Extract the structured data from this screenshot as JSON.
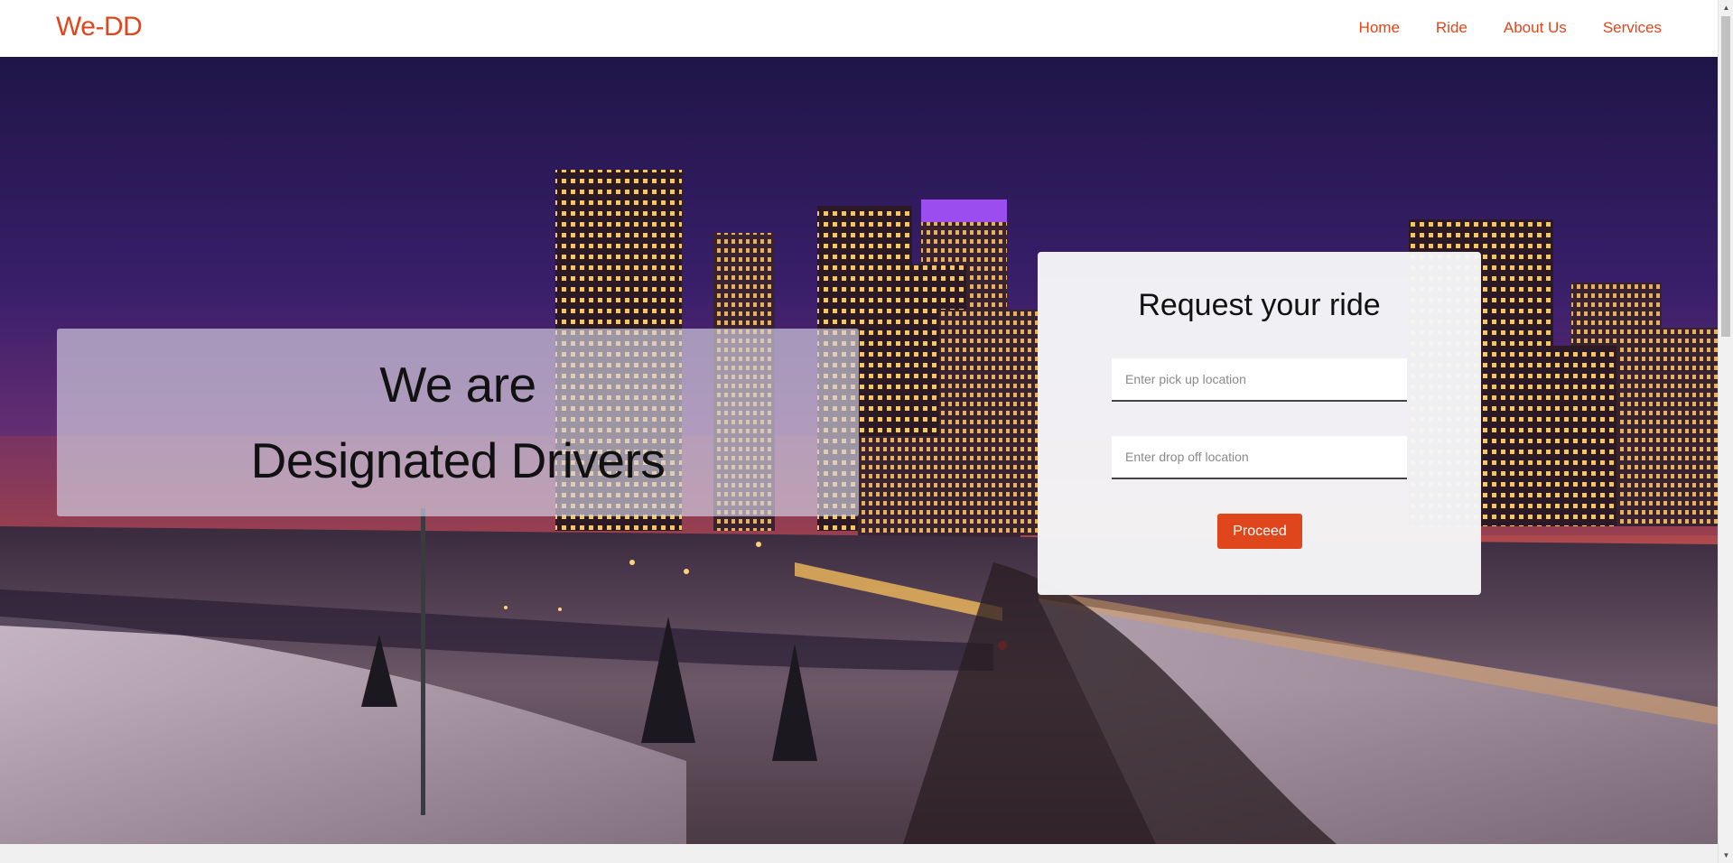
{
  "colors": {
    "accent": "#e0461c",
    "nav_text": "#e0461c",
    "button_bg": "#e0461c"
  },
  "navbar": {
    "brand": "We-DD",
    "links": [
      {
        "label": "Home"
      },
      {
        "label": "Ride"
      },
      {
        "label": "About Us"
      },
      {
        "label": "Services"
      }
    ]
  },
  "hero": {
    "headline_line1": "We are",
    "headline_line2": "Designated Drivers",
    "background_image": "city-skyline-night"
  },
  "ride_form": {
    "title": "Request your ride",
    "pickup": {
      "placeholder": "Enter pick up location",
      "value": ""
    },
    "dropoff": {
      "placeholder": "Enter drop off location",
      "value": ""
    },
    "submit_label": "Proceed"
  },
  "scrollbar": {
    "up_icon": "triangle-up-icon",
    "down_icon": "triangle-down-icon"
  }
}
